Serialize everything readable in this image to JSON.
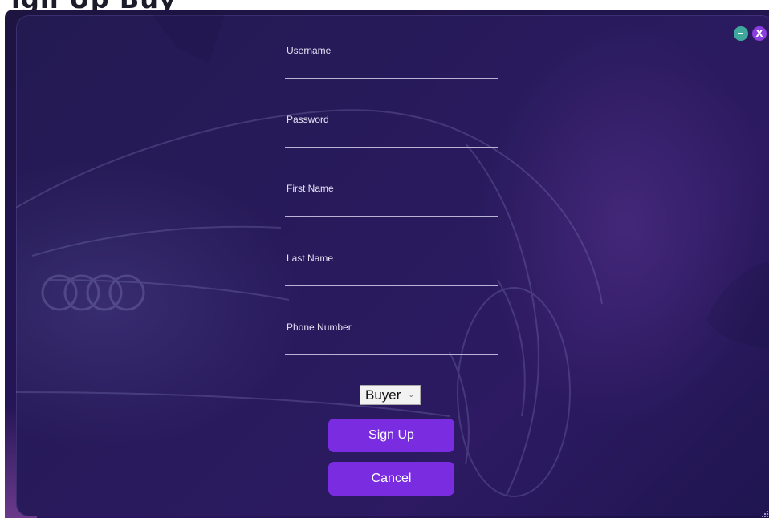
{
  "header": {
    "partial_title": "ign Up Buy"
  },
  "window": {
    "minimize_label": "",
    "close_label": "X"
  },
  "form": {
    "fields": [
      {
        "label": "Username",
        "value": "",
        "placeholder": ""
      },
      {
        "label": "Password",
        "value": "",
        "placeholder": ""
      },
      {
        "label": "First Name",
        "value": "",
        "placeholder": ""
      },
      {
        "label": "Last Name",
        "value": "",
        "placeholder": ""
      },
      {
        "label": "Phone Number",
        "value": "",
        "placeholder": ""
      }
    ],
    "role": {
      "selected": "Buyer"
    },
    "signup_label": "Sign Up",
    "cancel_label": "Cancel"
  },
  "icons": {
    "minimize": "minimize-icon",
    "close": "close-icon",
    "dropdown": "chevron-down-icon",
    "grip": "resize-grip-icon"
  },
  "colors": {
    "accent": "#7a2de0",
    "background": "#261a58",
    "minimize": "#3fa79b",
    "close": "#8c3ee0"
  }
}
